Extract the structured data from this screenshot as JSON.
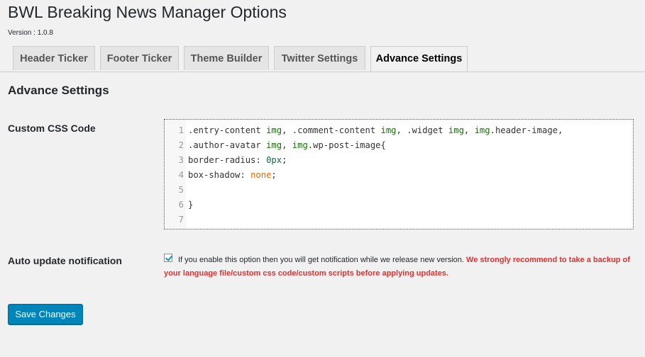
{
  "page": {
    "title": "BWL Breaking News Manager Options",
    "version": "Version : 1.0.8"
  },
  "tabs": [
    {
      "label": "Header Ticker",
      "active": false
    },
    {
      "label": "Footer Ticker",
      "active": false
    },
    {
      "label": "Theme Builder",
      "active": false
    },
    {
      "label": "Twitter Settings",
      "active": false
    },
    {
      "label": "Advance Settings",
      "active": true
    }
  ],
  "section": {
    "title": "Advance Settings"
  },
  "custom_css": {
    "label": "Custom CSS Code",
    "line_numbers": [
      "1",
      "2",
      "3",
      "4",
      "5",
      "6",
      "7"
    ],
    "lines": [
      [
        {
          "t": ".entry-content ",
          "c": ""
        },
        {
          "t": "img",
          "c": "kw"
        },
        {
          "t": ", .comment-content ",
          "c": ""
        },
        {
          "t": "img",
          "c": "kw"
        },
        {
          "t": ", .widget ",
          "c": ""
        },
        {
          "t": "img",
          "c": "kw"
        },
        {
          "t": ", ",
          "c": ""
        },
        {
          "t": "img",
          "c": "kw"
        },
        {
          "t": ".header-image,",
          "c": ""
        }
      ],
      [
        {
          "t": ".author-avatar ",
          "c": ""
        },
        {
          "t": "img",
          "c": "kw"
        },
        {
          "t": ", ",
          "c": ""
        },
        {
          "t": "img",
          "c": "kw"
        },
        {
          "t": ".wp-post-image{",
          "c": ""
        }
      ],
      [
        {
          "t": "border-radius: ",
          "c": ""
        },
        {
          "t": "0px",
          "c": "num"
        },
        {
          "t": ";",
          "c": ""
        }
      ],
      [
        {
          "t": "box-shadow: ",
          "c": ""
        },
        {
          "t": "none",
          "c": "atom"
        },
        {
          "t": ";",
          "c": ""
        }
      ],
      [],
      [
        {
          "t": "}",
          "c": ""
        }
      ],
      []
    ]
  },
  "auto_update": {
    "label": "Auto update notification",
    "checked": true,
    "description": "If you enable this option then you will get notification while we release new version.",
    "warning": "We strongly recommend to take a backup of your language file/custom css code/custom scripts before applying updates."
  },
  "actions": {
    "save_label": "Save Changes"
  },
  "colors": {
    "primary_button": "#0085ba",
    "warning_text": "#dc3232",
    "css_keyword": "#117700",
    "css_atom": "#e56b00"
  }
}
